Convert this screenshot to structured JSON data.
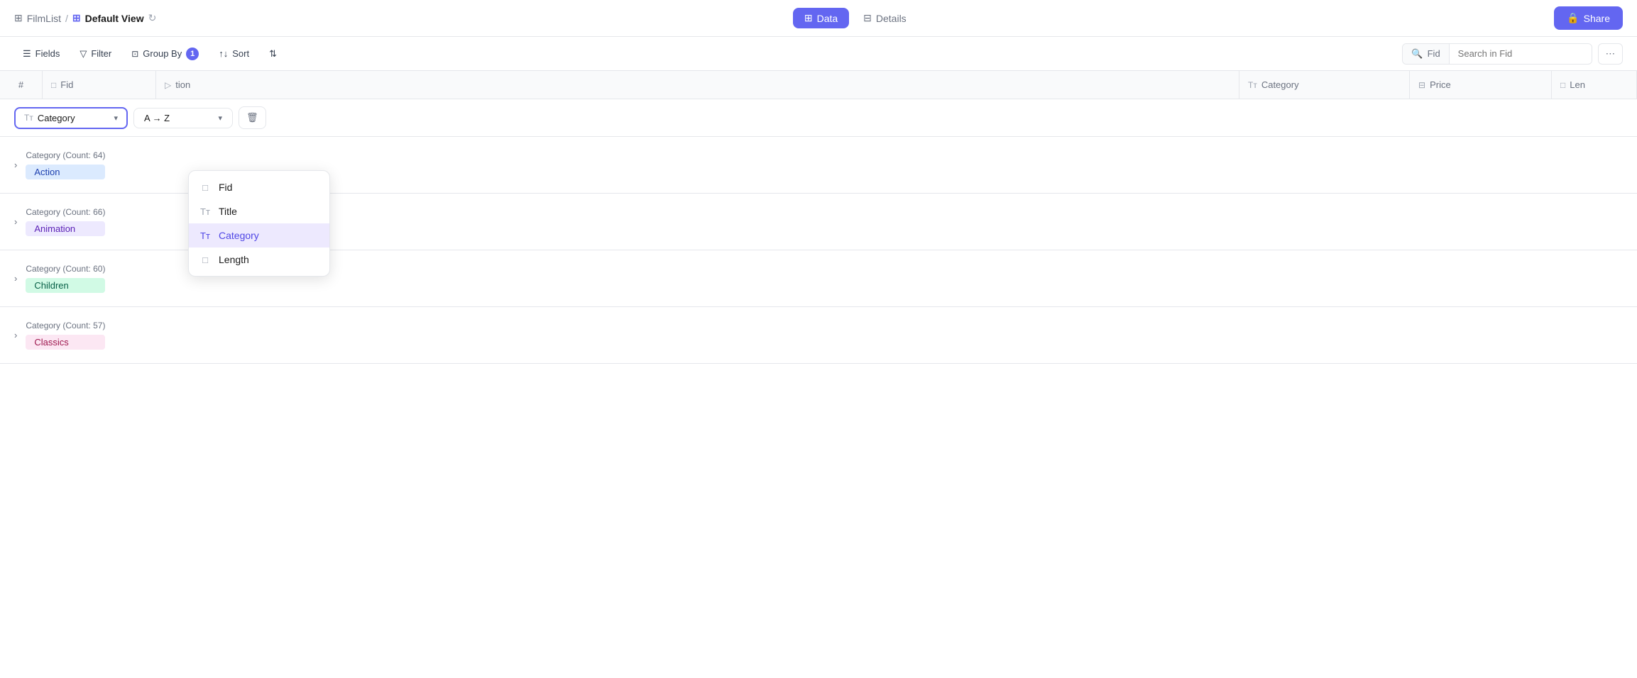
{
  "app": {
    "table_name": "FilmList",
    "view_icon": "⊞",
    "view_name": "Default View",
    "refresh_icon": "↻"
  },
  "tabs": [
    {
      "id": "data",
      "label": "Data",
      "icon": "⊞",
      "active": true
    },
    {
      "id": "details",
      "label": "Details",
      "icon": "⊟",
      "active": false
    }
  ],
  "share_button": "Share",
  "toolbar": {
    "fields_label": "Fields",
    "filter_label": "Filter",
    "groupby_label": "Group By",
    "groupby_count": "1",
    "sort_label": "Sort",
    "toggle_icon": "⇅"
  },
  "search": {
    "fid_label": "Fid",
    "placeholder": "Search in Fid"
  },
  "columns": [
    {
      "id": "hash",
      "label": "#",
      "icon": "#"
    },
    {
      "id": "fid",
      "label": "Fid",
      "icon": "□"
    },
    {
      "id": "action",
      "label": "tion",
      "icon": "▷"
    },
    {
      "id": "category",
      "label": "Category",
      "icon": "Tт"
    },
    {
      "id": "price",
      "label": "Price",
      "icon": "⊟"
    },
    {
      "id": "length",
      "label": "Len",
      "icon": "□"
    }
  ],
  "groupby_bar": {
    "selected_field": "Category",
    "selected_field_icon": "Tт",
    "sort_order": "A → Z",
    "delete_icon": "🗑"
  },
  "dropdown": {
    "items": [
      {
        "id": "fid",
        "label": "Fid",
        "icon": "□",
        "selected": false
      },
      {
        "id": "title",
        "label": "Title",
        "icon": "Tт",
        "selected": false
      },
      {
        "id": "category",
        "label": "Category",
        "icon": "Tт",
        "selected": true
      },
      {
        "id": "length",
        "label": "Length",
        "icon": "□",
        "selected": false
      }
    ]
  },
  "groups": [
    {
      "id": "action",
      "field": "Category",
      "count": 64,
      "label": "Action",
      "badge_class": "badge-action"
    },
    {
      "id": "animation",
      "field": "Category",
      "count": 66,
      "label": "Animation",
      "badge_class": "badge-animation"
    },
    {
      "id": "children",
      "field": "Category",
      "count": 60,
      "label": "Children",
      "badge_class": "badge-children"
    },
    {
      "id": "classics",
      "field": "Category",
      "count": 57,
      "label": "Classics",
      "badge_class": "badge-classics"
    }
  ]
}
